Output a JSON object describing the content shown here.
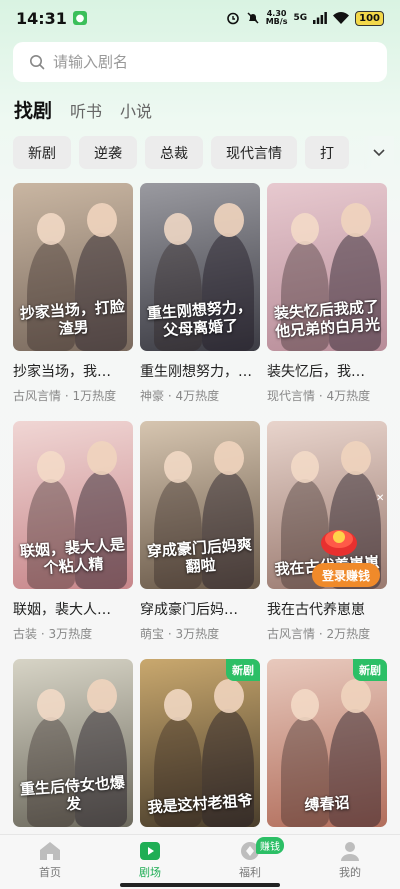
{
  "status": {
    "time": "14:31",
    "net_speed_top": "4.30",
    "net_speed_bottom": "MB/s",
    "signal": "5G",
    "battery": "100"
  },
  "search": {
    "placeholder": "请输入剧名"
  },
  "tabs": [
    {
      "label": "找剧",
      "active": true
    },
    {
      "label": "听书",
      "active": false
    },
    {
      "label": "小说",
      "active": false
    }
  ],
  "chips": [
    "新剧",
    "逆袭",
    "总裁",
    "现代言情",
    "打"
  ],
  "dramas": [
    {
      "title": "抄家当场，我…",
      "meta": "古风言情 · 1万热度",
      "poster_text": "抄家当场，打脸渣男",
      "colors": [
        "#c9b6a2",
        "#7a6a5e"
      ],
      "badge": ""
    },
    {
      "title": "重生刚想努力，…",
      "meta": "神豪 · 4万热度",
      "poster_text": "重生刚想努力，父母离婚了",
      "colors": [
        "#9a9aa0",
        "#3c3c44"
      ],
      "badge": ""
    },
    {
      "title": "装失忆后，我…",
      "meta": "现代言情 · 4万热度",
      "poster_text": "装失忆后我成了他兄弟的白月光",
      "colors": [
        "#e7c9cf",
        "#b88d99"
      ],
      "badge": ""
    },
    {
      "title": "联姻，裴大人…",
      "meta": "古装 · 3万热度",
      "poster_text": "联姻，裴大人是个粘人精",
      "colors": [
        "#f0d6d4",
        "#c7868a"
      ],
      "badge": ""
    },
    {
      "title": "穿成豪门后妈…",
      "meta": "萌宝 · 3万热度",
      "poster_text": "穿成豪门后妈爽翻啦",
      "colors": [
        "#d6c5b0",
        "#6a5a4a"
      ],
      "badge": ""
    },
    {
      "title": "我在古代养崽崽",
      "meta": "古风言情 · 2万热度",
      "poster_text": "我在古代养崽崽",
      "colors": [
        "#e8d4cc",
        "#9a7a70"
      ],
      "badge": ""
    },
    {
      "title": "",
      "meta": "",
      "poster_text": "重生后侍女也爆发",
      "colors": [
        "#d7d4c6",
        "#6d6a5e"
      ],
      "badge": ""
    },
    {
      "title": "",
      "meta": "",
      "poster_text": "我是这村老祖爷",
      "colors": [
        "#c9a86e",
        "#4a3e2c"
      ],
      "badge": "新剧"
    },
    {
      "title": "",
      "meta": "",
      "poster_text": "缚春诏",
      "colors": [
        "#e8c9bd",
        "#b26e5c"
      ],
      "badge": "新剧"
    }
  ],
  "float_earn": "登录赚钱",
  "nav": [
    {
      "label": "首页",
      "icon": "home-icon",
      "active": false
    },
    {
      "label": "剧场",
      "icon": "play-icon",
      "active": true
    },
    {
      "label": "福利",
      "icon": "coin-icon",
      "active": false,
      "badge": "赚钱"
    },
    {
      "label": "我的",
      "icon": "profile-icon",
      "active": false
    }
  ]
}
